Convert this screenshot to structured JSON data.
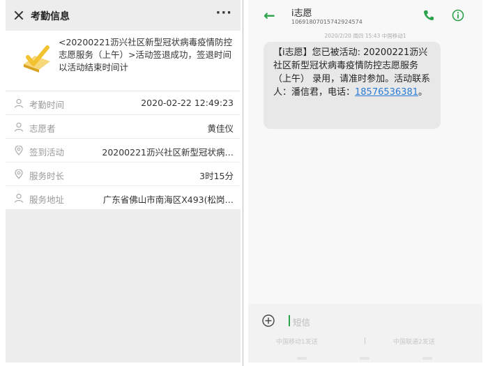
{
  "left": {
    "header": {
      "title": "考勤信息",
      "more": "···"
    },
    "notice": "<20200221沥兴社区新型冠状病毒疫情防控志愿服务（上午）>活动签退成功，签退时间以活动结束时间计",
    "rows": [
      {
        "label": "考勤时间",
        "value": "2020-02-22 12:49:23"
      },
      {
        "label": "志愿者",
        "value": "黄佳仪"
      },
      {
        "label": "签到活动",
        "value": "20200221沥兴社区新型冠状病…"
      },
      {
        "label": "服务时长",
        "value": "3时15分"
      },
      {
        "label": "服务地址",
        "value": "广东省佛山市南海区X493(松岗…"
      }
    ]
  },
  "right": {
    "contact_name": "i志愿",
    "contact_number": "1069180701574292457​4",
    "timestamp": "2020/2/20 周四 15:43 中国移动1",
    "message": "【i志愿】您已被活动: 20200221沥兴社区新型冠状病毒疫情防控志愿服务（上午） 录用，请准时参加。活动联系人：潘信君，电话：",
    "phone_link": "18576536381",
    "message_tail": "。",
    "input_placeholder": "短信",
    "sim1": "中国移动1发送",
    "sim2": "中国联通2发送"
  },
  "colors": {
    "accent_green": "#2aa24a",
    "link_blue": "#2a7ad8",
    "check_yellow": "#f2c230"
  }
}
